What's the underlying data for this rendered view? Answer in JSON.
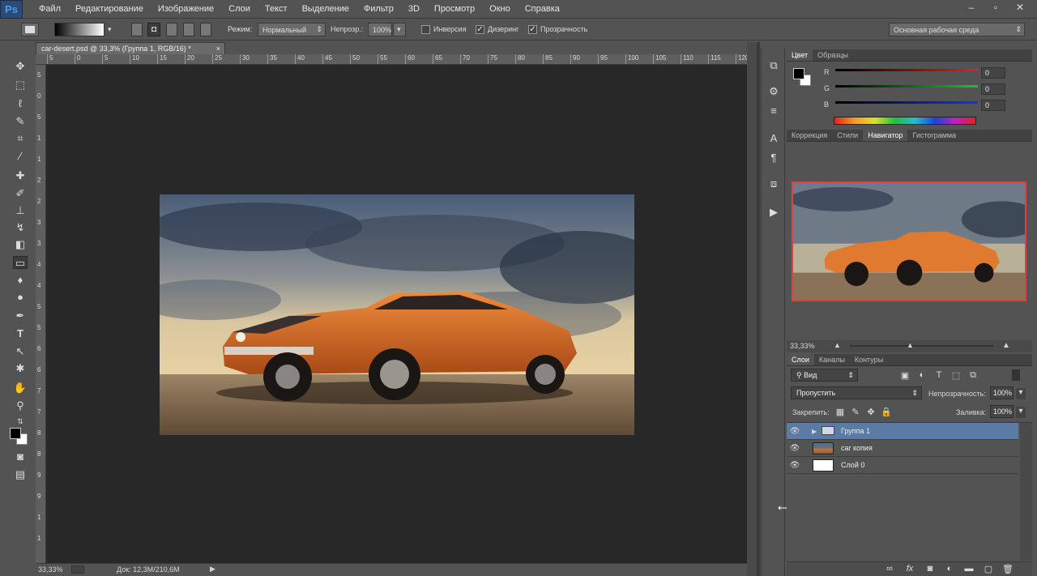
{
  "app": {
    "logo": "Ps"
  },
  "menu": [
    "Файл",
    "Редактирование",
    "Изображение",
    "Слои",
    "Текст",
    "Выделение",
    "Фильтр",
    "3D",
    "Просмотр",
    "Окно",
    "Справка"
  ],
  "window_controls": [
    "–",
    "▫",
    "✕"
  ],
  "options": {
    "mode_label": "Режим:",
    "mode_value": "Нормальный",
    "opacity_label": "Непрозр.:",
    "opacity_value": "100%",
    "inverse_label": "Инверсия",
    "dither_label": "Дизеринг",
    "transparency_label": "Прозрачность",
    "workspace_value": "Основная рабочая среда"
  },
  "document": {
    "tab_title": "car-desert.psd @ 33,3% (Группа 1, RGB/16) *",
    "ruler_h": [
      "5",
      "0",
      "5",
      "10",
      "15",
      "20",
      "25",
      "30",
      "35",
      "40",
      "45",
      "50",
      "55",
      "60",
      "65",
      "70",
      "75",
      "80",
      "85",
      "90",
      "95",
      "100",
      "105",
      "110",
      "115",
      "120"
    ],
    "ruler_v": [
      "5",
      "0",
      "5",
      "1",
      "1",
      "2",
      "2",
      "3",
      "3",
      "4",
      "4",
      "5",
      "5",
      "6",
      "6",
      "7",
      "7",
      "8",
      "8",
      "9",
      "9",
      "1",
      "1"
    ],
    "zoom": "33,33%",
    "doc_info": "Док: 12,3M/210,6M"
  },
  "color_panel": {
    "tabs": [
      "Цвет",
      "Образцы"
    ],
    "channels": [
      {
        "name": "R",
        "value": "0",
        "color": "#e02020"
      },
      {
        "name": "G",
        "value": "0",
        "color": "#20c030"
      },
      {
        "name": "B",
        "value": "0",
        "color": "#2030e0"
      }
    ]
  },
  "navigator_panel": {
    "tabs": [
      "Коррекция",
      "Стили",
      "Навигатор",
      "Гистограмма"
    ],
    "zoom": "33,33%",
    "frame_color": "#e04040"
  },
  "layers_panel": {
    "tabs": [
      "Слои",
      "Каналы",
      "Контуры"
    ],
    "filter_value": "Вид",
    "blend_value": "Пропустить",
    "opacity_label": "Непрозрачность:",
    "opacity_value": "100%",
    "lock_label": "Закрепить:",
    "fill_label": "Заливка:",
    "fill_value": "100%",
    "layers": [
      {
        "name": "Группа 1",
        "type": "group",
        "selected": true
      },
      {
        "name": "car  копия",
        "type": "image",
        "selected": false
      },
      {
        "name": "Слой 0",
        "type": "fill",
        "selected": false
      }
    ],
    "footer_icons": [
      "link-icon",
      "fx-icon",
      "mask-icon",
      "adjustment-icon",
      "folder-icon",
      "new-layer-icon",
      "trash-icon"
    ]
  }
}
